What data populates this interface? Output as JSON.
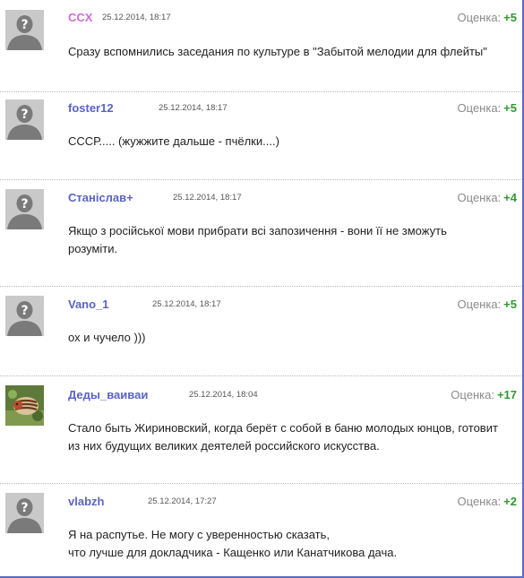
{
  "score_label": "Оценка:",
  "colors": {
    "author": "#5a63c4",
    "author_highlight": "#d26ad6",
    "score_positive": "#2f9a2f",
    "border": "#5b6bbf"
  },
  "comments": [
    {
      "author": "CCX",
      "date": "25.12.2014, 18:17",
      "score": "+5",
      "avatar": "default-avatar-icon",
      "lines": [
        "Сразу вспомнились заседания по культуре в \"Забытой мелодии для флейты\""
      ]
    },
    {
      "author": "foster12",
      "date": "25.12.2014, 18:17",
      "score": "+5",
      "avatar": "default-avatar-icon",
      "lines": [
        "СССР..... (жужжите дальше - пчёлки....)"
      ]
    },
    {
      "author": "Станіслав+",
      "date": "25.12.2014, 18:17",
      "score": "+4",
      "avatar": "default-avatar-icon",
      "lines": [
        "Якщо з російської мови прибрати всі запозичення - вони її не зможуть",
        "розуміти."
      ]
    },
    {
      "author": "Vano_1",
      "date": "25.12.2014, 18:17",
      "score": "+5",
      "avatar": "default-avatar-icon",
      "lines": [
        "ох и чучело )))"
      ]
    },
    {
      "author": "Деды_ваиваи",
      "date": "25.12.2014, 18:04",
      "score": "+17",
      "avatar": "beetle-avatar-icon",
      "lines": [
        "Стало быть Жириновский, когда берёт с собой в баню молодых юнцов, готовит",
        "из них будущих великих деятелей российского искусства."
      ]
    },
    {
      "author": "vlabzh",
      "date": "25.12.2014, 17:27",
      "score": "+2",
      "avatar": "default-avatar-icon",
      "lines": [
        "Я на распутье. Не могу с уверенностью сказать,",
        "что лучше для докладчика - Кащенко или Канатчикова дача."
      ]
    }
  ]
}
